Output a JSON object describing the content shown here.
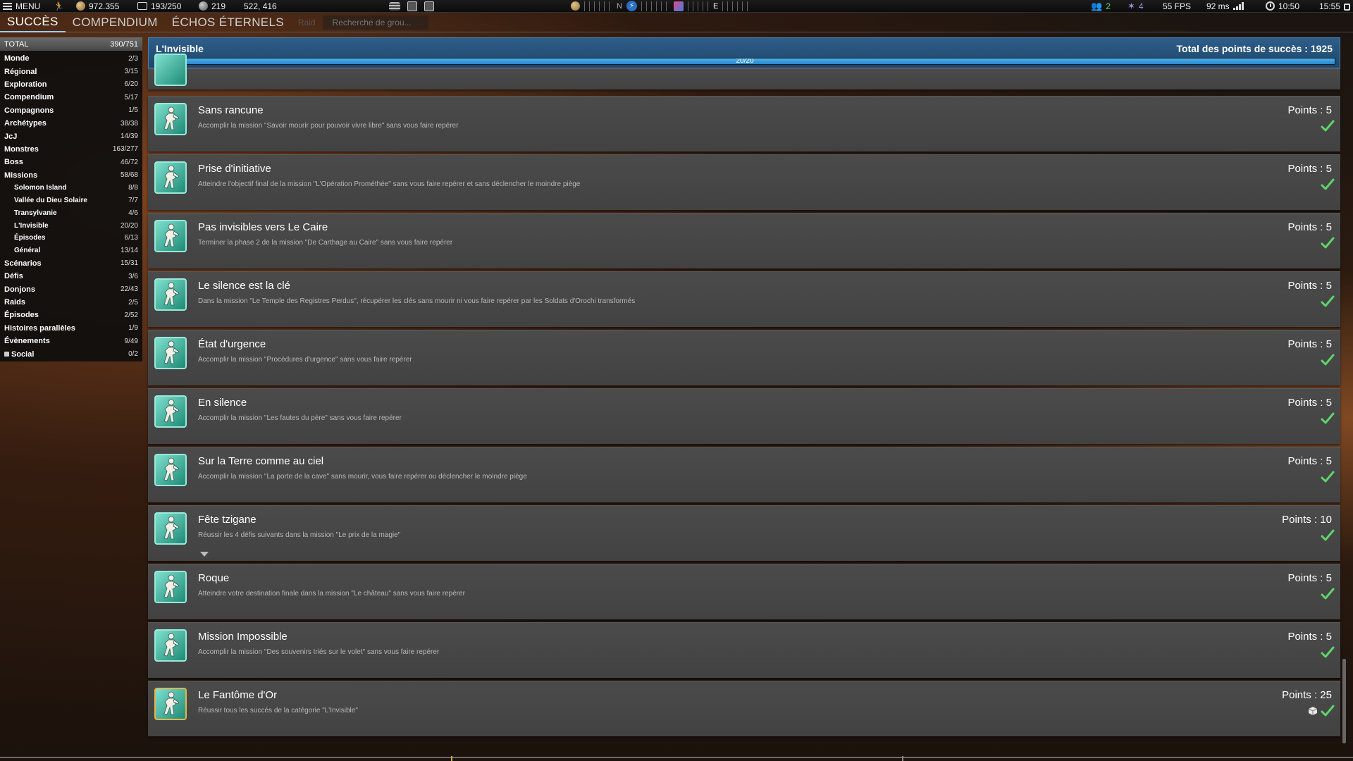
{
  "topbar": {
    "menu_label": "MENU",
    "currency_a": "972.355",
    "inventory": "193/250",
    "currency_b": "219",
    "coords": "522, 416",
    "compass_n": "N",
    "compass_e": "E",
    "group_count": "2",
    "star_count": "4",
    "fps": "55 FPS",
    "ping": "92 ms",
    "time_a": "10:50",
    "time_b": "15:55"
  },
  "tabs": [
    {
      "label": "Succès"
    },
    {
      "label": "Compendium"
    },
    {
      "label": "Échos éternels"
    }
  ],
  "tabs_extra": {
    "raid": "Raid",
    "search_placeholder": "Recherche de grou..."
  },
  "sidebar": {
    "total_label": "TOTAL",
    "total_count": "390/751",
    "items": [
      {
        "label": "Monde",
        "count": "2/3"
      },
      {
        "label": "Régional",
        "count": "3/15"
      },
      {
        "label": "Exploration",
        "count": "6/20"
      },
      {
        "label": "Compendium",
        "count": "5/17"
      },
      {
        "label": "Compagnons",
        "count": "1/5"
      },
      {
        "label": "Archétypes",
        "count": "38/38"
      },
      {
        "label": "JcJ",
        "count": "14/39"
      },
      {
        "label": "Monstres",
        "count": "163/277"
      },
      {
        "label": "Boss",
        "count": "46/72"
      },
      {
        "label": "Missions",
        "count": "58/68"
      }
    ],
    "sub_items": [
      {
        "label": "Solomon Island",
        "count": "8/8"
      },
      {
        "label": "Vallée du Dieu Solaire",
        "count": "7/7"
      },
      {
        "label": "Transylvanie",
        "count": "4/6"
      },
      {
        "label": "L'Invisible",
        "count": "20/20"
      },
      {
        "label": "Épisodes",
        "count": "6/13"
      },
      {
        "label": "Général",
        "count": "13/14"
      }
    ],
    "items_after": [
      {
        "label": "Scénarios",
        "count": "15/31"
      },
      {
        "label": "Défis",
        "count": "3/6"
      },
      {
        "label": "Donjons",
        "count": "22/43"
      },
      {
        "label": "Raids",
        "count": "2/5"
      },
      {
        "label": "Épisodes",
        "count": "2/52"
      },
      {
        "label": "Histoires parallèles",
        "count": "1/9"
      },
      {
        "label": "Évènements",
        "count": "9/49"
      },
      {
        "label": "Social",
        "count": "0/2"
      }
    ]
  },
  "header": {
    "title": "L'Invisible",
    "total_points": "Total des points de succès : 1925",
    "progress_label": "20/20",
    "progress_fraction": 1.0
  },
  "achievements": [
    {
      "name": "Sans rancune",
      "desc": "Accomplir la mission \"Savoir mourir pour pouvoir vivre libre\" sans vous faire repérer",
      "points": "Points : 5"
    },
    {
      "name": "Prise d'initiative",
      "desc": "Atteindre l'objectif final de la mission \"L'Opération Prométhée\" sans vous faire repérer et sans déclencher le moindre piège",
      "points": "Points : 5"
    },
    {
      "name": "Pas invisibles vers Le Caire",
      "desc": "Terminer la phase 2 de la mission \"De Carthage au Caire\" sans vous faire repérer",
      "points": "Points : 5"
    },
    {
      "name": "Le silence est la clé",
      "desc": "Dans la mission \"Le Temple des Registres Perdus\", récupérer les clés sans mourir ni vous faire repérer par les Soldats d'Orochi transformés",
      "points": "Points : 5"
    },
    {
      "name": "État d'urgence",
      "desc": "Accomplir la mission \"Procédures d'urgence\" sans vous faire repérer",
      "points": "Points : 5"
    },
    {
      "name": "En silence",
      "desc": "Accomplir la mission \"Les fautes du père\" sans vous faire repérer",
      "points": "Points : 5"
    },
    {
      "name": "Sur la Terre comme au ciel",
      "desc": "Accomplir la mission \"La porte de la cave\" sans mourir, vous faire repérer ou déclencher le moindre piège",
      "points": "Points : 5"
    },
    {
      "name": "Fête tzigane",
      "desc": "Réussir les 4 défis suivants dans la mission \"Le prix de la magie\"",
      "points": "Points : 10"
    },
    {
      "name": "Roque",
      "desc": "Atteindre votre destination finale dans la mission \"Le château\" sans vous faire repérer",
      "points": "Points : 5"
    },
    {
      "name": "Mission Impossible",
      "desc": "Accomplir la mission \"Des souvenirs triés sur le volet\" sans vous faire repérer",
      "points": "Points : 5"
    },
    {
      "name": "Le Fantôme d'Or",
      "desc": "Réussir tous les succès de la catégorie \"L'Invisible\"",
      "points": "Points : 25"
    }
  ],
  "colors": {
    "accent_blue": "#2a86c9",
    "check_green": "#5fd46a",
    "row_bg": "#454545"
  }
}
